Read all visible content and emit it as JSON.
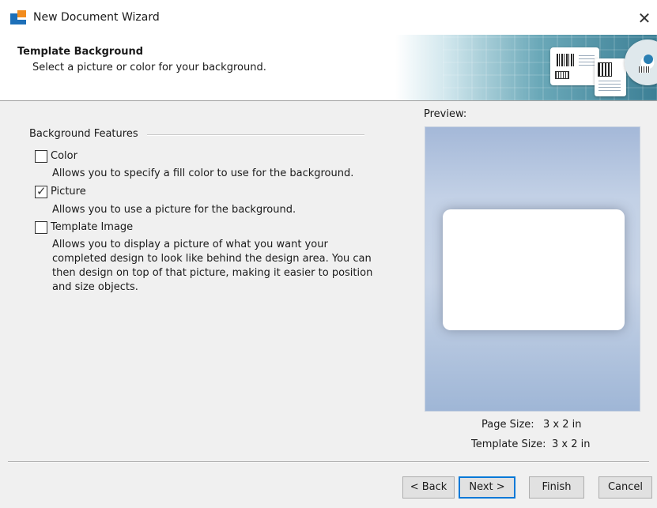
{
  "window": {
    "title": "New Document Wizard",
    "close_glyph": "✕"
  },
  "header": {
    "title": "Template Background",
    "subtitle": "Select a picture or color for your background."
  },
  "background_features": {
    "group_label": "Background Features",
    "options": [
      {
        "label": "Color",
        "checked": false,
        "description": "Allows you to specify a fill color to use for the background."
      },
      {
        "label": "Picture",
        "checked": true,
        "description": "Allows you to use a picture for the background."
      },
      {
        "label": "Template Image",
        "checked": false,
        "description": "Allows you to display a picture of what you want your completed design to look like behind the design area. You can then design on top of that picture, making it easier to position and size objects."
      }
    ]
  },
  "preview": {
    "label": "Preview:",
    "page_size_label": "Page Size:",
    "page_size_value": "3 x 2 in",
    "template_size_label": "Template Size:",
    "template_size_value": "3 x 2 in"
  },
  "buttons": {
    "back": "< Back",
    "next": "Next >",
    "finish": "Finish",
    "cancel": "Cancel"
  },
  "colors": {
    "accent": "#0078d7",
    "preview_background": "#b6c7e0"
  },
  "checkmark_glyph": "✓"
}
